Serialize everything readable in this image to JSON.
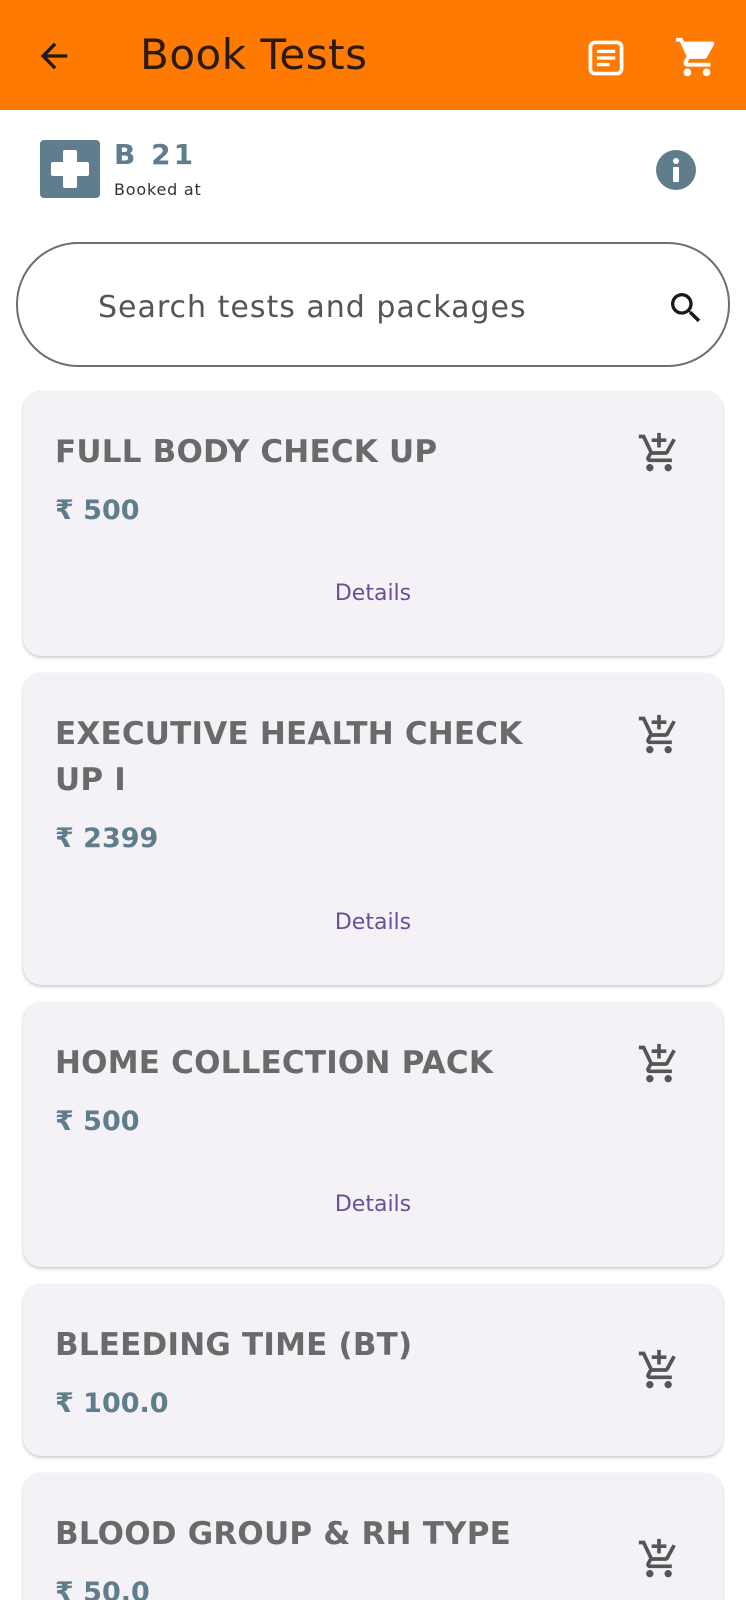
{
  "header": {
    "title": "Book Tests",
    "back_icon": "arrow-back-icon",
    "orders_icon": "orders-list-icon",
    "cart_icon": "shopping-cart-icon",
    "bar_color": "#ff7a00"
  },
  "lab": {
    "name": "B 21",
    "subtitle": "Booked at",
    "logo_icon": "medical-cross-icon",
    "info_icon": "info-icon",
    "accent_color": "#5f7d8c"
  },
  "search": {
    "placeholder": "Search tests and packages",
    "icon": "search-icon"
  },
  "tests": [
    {
      "name": "FULL BODY CHECK UP",
      "price": "₹ 500",
      "details": "Details"
    },
    {
      "name": "EXECUTIVE HEALTH CHECK UP I",
      "price": "₹ 2399",
      "details": "Details"
    },
    {
      "name": "HOME COLLECTION PACK",
      "price": "₹ 500",
      "details": "Details"
    },
    {
      "name": "BLEEDING TIME (BT)",
      "price": "₹ 100.0"
    },
    {
      "name": "BLOOD GROUP & RH TYPE",
      "price": "₹ 50.0"
    }
  ]
}
